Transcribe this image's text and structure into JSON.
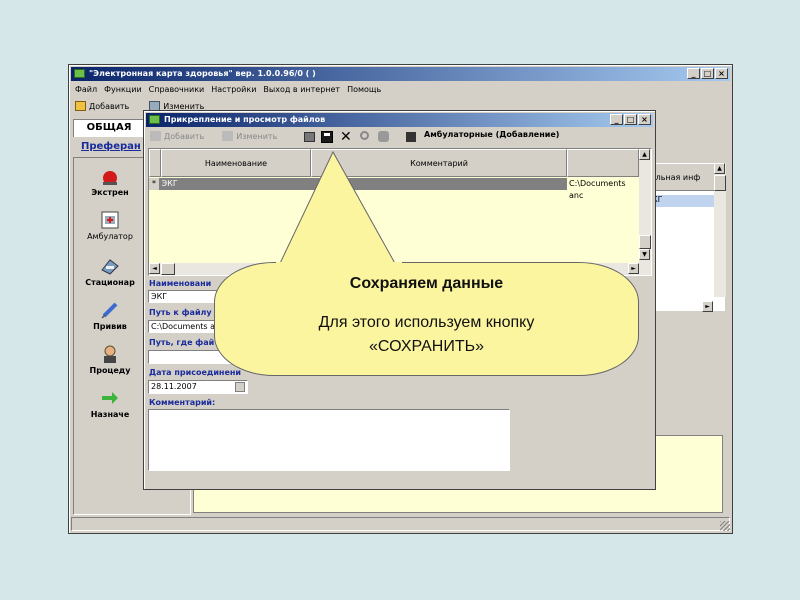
{
  "main_window": {
    "title": "\"Электронная карта здоровья\" вер. 1.0.0.96/0 ( )",
    "menu": [
      "Файл",
      "Функции",
      "Справочники",
      "Настройки",
      "Выход в интернет",
      "Помощь"
    ],
    "toolbar": {
      "add": "Добавить",
      "edit": "Изменить"
    },
    "tab": "ОБЩАЯ",
    "link": "Преферан",
    "sidebar": [
      "Экстрен",
      "Амбулатор",
      "Стационар",
      "Привив",
      "Процеду",
      "Назначе"
    ],
    "right_header": "тельная инф",
    "right_cell": "КГ"
  },
  "dialog": {
    "title": "Прикрепление и просмотр файлов",
    "toolbar": {
      "add": "Добавить",
      "edit": "Изменить",
      "context": "Амбулаторные  (Добавление)"
    },
    "columns": [
      "Наименование",
      "Комментарий"
    ],
    "row": {
      "marker": "*",
      "name": "ЭКГ",
      "path": "C:\\Documents anc"
    },
    "form": {
      "name_label": "Наименовани",
      "name_value": "ЭКГ",
      "path_label": "Путь к файлу",
      "path_value": "C:\\Documents ar",
      "save_path_label": "Путь, где фай",
      "date_label": "Дата присоединени",
      "date_value": "28.11.2007",
      "comment_label": "Комментарий:"
    }
  },
  "callout": {
    "title": "Сохраняем данные",
    "body": "Для этого используем кнопку «СОХРАНИТЬ»",
    "fill": "#fcf5a0"
  }
}
